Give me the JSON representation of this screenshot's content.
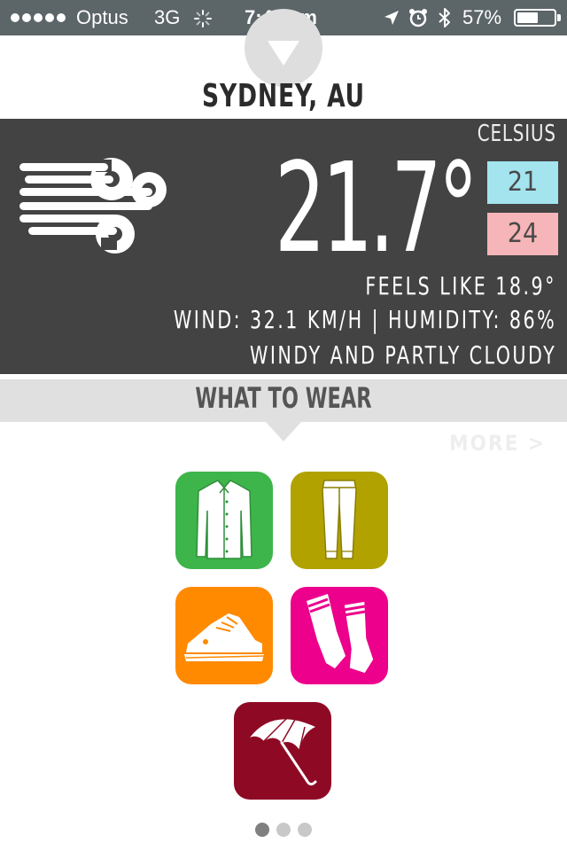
{
  "status_bar": {
    "carrier": "Optus",
    "network": "3G",
    "time": "7:44 am",
    "battery_text": "57%",
    "battery_level": 0.57,
    "icons": [
      "signal-dots-icon",
      "activity-spinner-icon",
      "location-arrow-icon",
      "alarm-clock-icon",
      "bluetooth-icon",
      "battery-icon"
    ]
  },
  "location": {
    "city": "SYDNEY, AU",
    "dropdown_icon": "chevron-down-icon"
  },
  "weather": {
    "unit": "CELSIUS",
    "temperature": "21.7°",
    "min": "21",
    "max": "24",
    "feels_like": "FEELS LIKE 18.9°",
    "wind_humidity": "WIND: 32.1 KM/H | HUMIDITY: 86%",
    "condition": "WINDY AND PARTLY CLOUDY",
    "icon": "wind-icon",
    "colors": {
      "panel": "#434343",
      "min_bg": "#a3e4ef",
      "max_bg": "#f6b5b8"
    }
  },
  "what_to_wear": {
    "title": "WHAT TO WEAR",
    "more_label": "MORE >",
    "items": [
      {
        "name": "shirt",
        "icon": "shirt-icon",
        "color": "#3db54a"
      },
      {
        "name": "pants",
        "icon": "pants-icon",
        "color": "#b1a200"
      },
      {
        "name": "sneakers",
        "icon": "sneaker-icon",
        "color": "#ff8a00"
      },
      {
        "name": "socks",
        "icon": "socks-icon",
        "color": "#ec008c"
      },
      {
        "name": "umbrella",
        "icon": "umbrella-icon",
        "color": "#8e0a24"
      }
    ]
  },
  "pagination": {
    "pages": 3,
    "current": 1
  }
}
